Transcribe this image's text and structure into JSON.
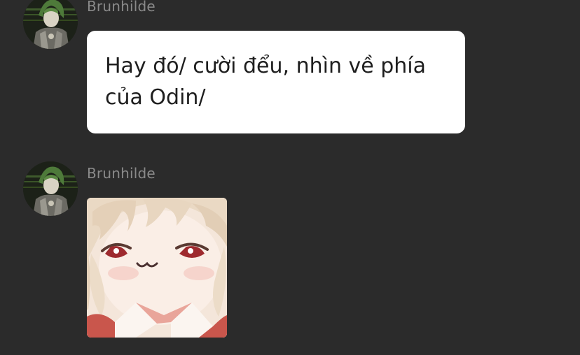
{
  "messages": [
    {
      "username": "Brunhilde",
      "type": "text",
      "text": "Hay đó/ cười đểu, nhìn về phía của Odin/",
      "avatar_icon": "knight-avatar-icon"
    },
    {
      "username": "Brunhilde",
      "type": "sticker",
      "sticker_icon": "smug-anime-girl-sticker",
      "avatar_icon": "knight-avatar-icon"
    }
  ],
  "colors": {
    "background": "#2b2b2b",
    "username": "#8a8a8a",
    "bubble": "#ffffff",
    "text": "#1e1e1e"
  }
}
